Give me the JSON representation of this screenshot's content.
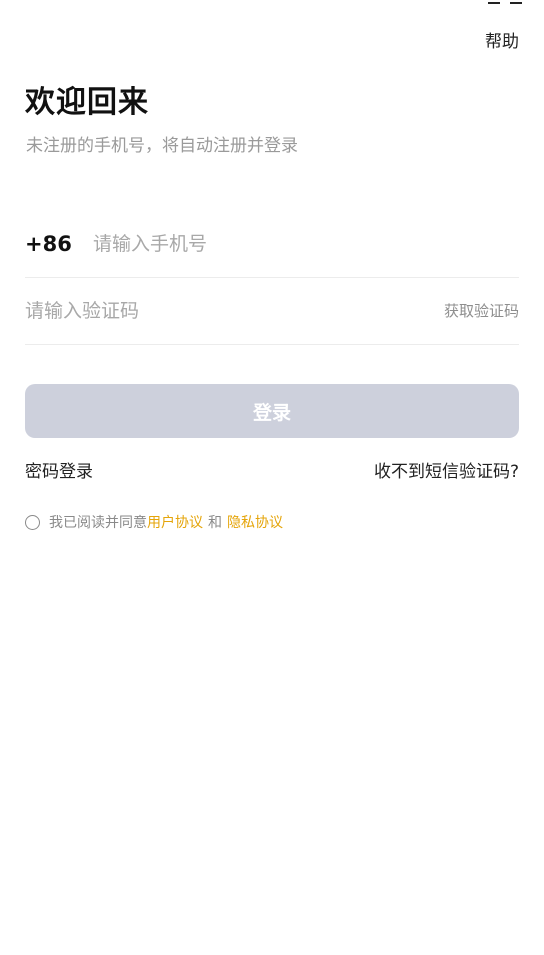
{
  "header": {
    "help_label": "帮助"
  },
  "main": {
    "title": "欢迎回来",
    "subtitle": "未注册的手机号，将自动注册并登录"
  },
  "phone": {
    "prefix": "+86",
    "placeholder": "请输入手机号",
    "value": ""
  },
  "code": {
    "placeholder": "请输入验证码",
    "value": "",
    "get_code_label": "获取验证码"
  },
  "login": {
    "button_label": "登录",
    "disabled_color": "#cdd0dc"
  },
  "links": {
    "password_login": "密码登录",
    "no_sms": "收不到短信验证码?"
  },
  "agreement": {
    "checked": false,
    "prefix_text": "我已阅读并同意",
    "user_agreement": "用户协议",
    "and_text": "和",
    "privacy_agreement": "隐私协议",
    "link_color": "#e5a50a"
  }
}
